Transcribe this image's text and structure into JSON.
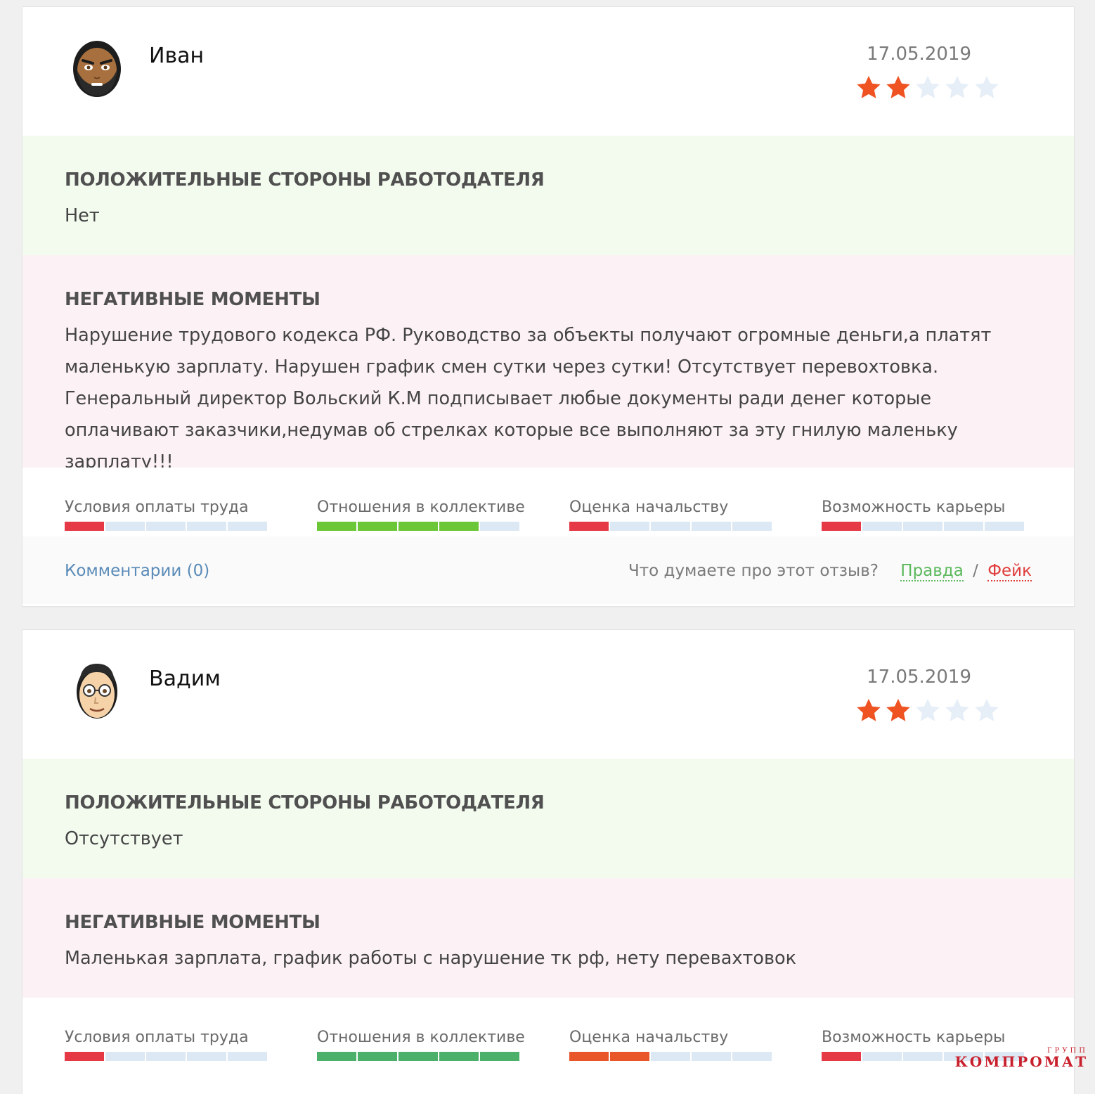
{
  "reviews": [
    {
      "author": "Иван",
      "avatar_icon": "bearded-man-avatar-icon",
      "date": "17.05.2019",
      "rating": 2,
      "rating_max": 5,
      "positive_title": "ПОЛОЖИТЕЛЬНЫЕ СТОРОНЫ РАБОТОДАТЕЛЯ",
      "positive_text": "Нет",
      "negative_title": "НЕГАТИВНЫЕ МОМЕНТЫ",
      "negative_text": "Нарушение трудового кодекса РФ. Руководство за объекты получают огромные деньги,а платят маленькую зарплату. Нарушен график смен сутки через сутки! Отсутствует перевохтовка. Генеральный директор Вольский К.М подписывает любые документы ради денег которые оплачивают заказчики,недумав об стрелках которые все выполняют за эту гнилую маленьку зарплату!!!",
      "scores": [
        {
          "label": "Условия оплаты труда",
          "value": 1,
          "color": "#e63946"
        },
        {
          "label": "Отношения в коллективе",
          "value": 4,
          "color": "#6cc738"
        },
        {
          "label": "Оценка начальству",
          "value": 1,
          "color": "#e63946"
        },
        {
          "label": "Возможность карьеры",
          "value": 1,
          "color": "#e63946"
        }
      ],
      "comments_label": "Комментарии (0)",
      "verdict_question": "Что думаете про этот отзыв?",
      "truth_label": "Правда",
      "separator": "/",
      "fake_label": "Фейк"
    },
    {
      "author": "Вадим",
      "avatar_icon": "man-with-glasses-avatar-icon",
      "date": "17.05.2019",
      "rating": 2,
      "rating_max": 5,
      "positive_title": "ПОЛОЖИТЕЛЬНЫЕ СТОРОНЫ РАБОТОДАТЕЛЯ",
      "positive_text": "Отсутствует",
      "negative_title": "НЕГАТИВНЫЕ МОМЕНТЫ",
      "negative_text": "Маленькая зарплата, график работы с нарушение тк рф, нету перевахтовок",
      "scores": [
        {
          "label": "Условия оплаты труда",
          "value": 1,
          "color": "#e63946"
        },
        {
          "label": "Отношения в коллективе",
          "value": 5,
          "color": "#4caf6a"
        },
        {
          "label": "Оценка начальству",
          "value": 2,
          "color": "#e8562a"
        },
        {
          "label": "Возможность карьеры",
          "value": 1,
          "color": "#e63946"
        }
      ]
    }
  ],
  "colors": {
    "star_on": "#ef5322",
    "star_off": "#e6eef7",
    "segment_empty": "#dce8f3",
    "positive_bg": "#f3fbef",
    "negative_bg": "#fcf1f5"
  },
  "watermark": {
    "small": "ГРУПП",
    "large": "КОМПРОМАТ"
  }
}
